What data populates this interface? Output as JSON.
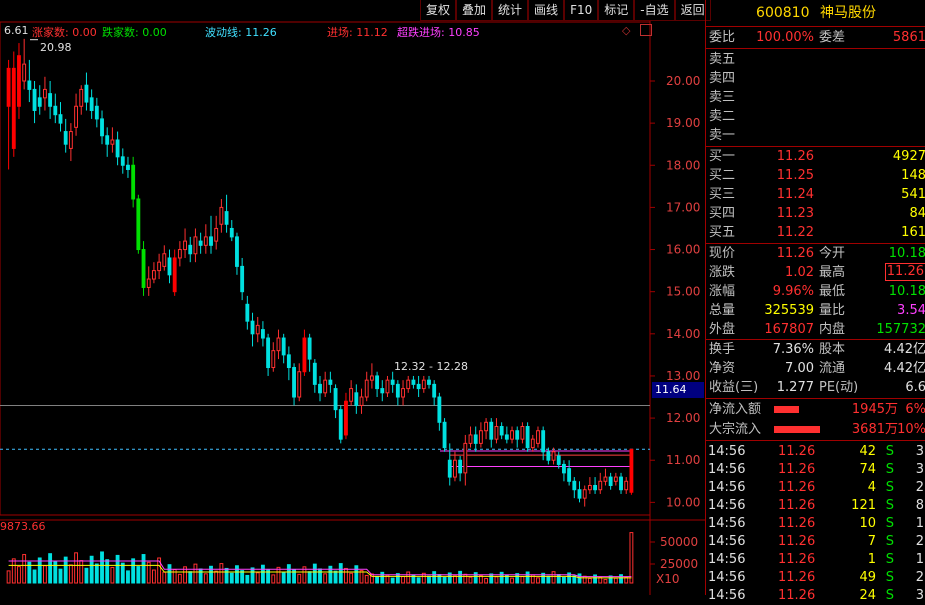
{
  "toolbar": [
    "复权",
    "叠加",
    "统计",
    "画线",
    "F10",
    "标记",
    "-自选",
    "返回"
  ],
  "legend": {
    "price_top": "6.61",
    "up_count": "涨家数: 0.00",
    "down_count": "跌家数: 0.00",
    "wave_line": "波动线: 11.26",
    "entry": "进场: 11.12",
    "super_entry": "超跌进场: 10.85"
  },
  "chart_labels": {
    "high_marker": "20.98",
    "range_label": "12.32 - 12.28",
    "current_price_tag": "11.64",
    "volume_value": "9873.66",
    "volume_ticks": [
      "50000",
      "25000",
      "X10"
    ]
  },
  "chart_data": {
    "type": "candlestick",
    "ylim": [
      9.7,
      21.4
    ],
    "y_ticks": [
      "20.00",
      "19.00",
      "18.00",
      "17.00",
      "16.00",
      "15.00",
      "14.00",
      "13.00",
      "12.00",
      "11.00",
      "10.00"
    ],
    "candles": [
      [
        19.4,
        20.3,
        20.5,
        17.9
      ],
      [
        18.4,
        20.3,
        20.7,
        18.2
      ],
      [
        19.4,
        20.6,
        20.9,
        19.1
      ],
      [
        20.0,
        20.4,
        21.0,
        19.8
      ],
      [
        20.0,
        19.8,
        20.5,
        19.5
      ],
      [
        19.8,
        19.3,
        20.0,
        19.0
      ],
      [
        19.6,
        19.4,
        19.9,
        19.2
      ],
      [
        19.6,
        19.8,
        20.1,
        19.3
      ],
      [
        19.7,
        19.4,
        20.0,
        19.1
      ],
      [
        19.4,
        19.2,
        19.7,
        19.0
      ],
      [
        19.2,
        19.0,
        19.5,
        18.8
      ],
      [
        18.8,
        18.5,
        19.1,
        18.3
      ],
      [
        18.4,
        18.8,
        19.0,
        18.1
      ],
      [
        18.9,
        19.4,
        19.7,
        18.7
      ],
      [
        19.4,
        19.8,
        19.9,
        19.2
      ],
      [
        19.9,
        19.5,
        20.2,
        19.3
      ],
      [
        19.6,
        19.3,
        19.8,
        19.1
      ],
      [
        19.4,
        19.1,
        19.6,
        18.9
      ],
      [
        19.1,
        18.7,
        19.3,
        18.5
      ],
      [
        18.7,
        18.5,
        18.9,
        18.2
      ],
      [
        18.5,
        18.6,
        18.9,
        18.3
      ],
      [
        18.6,
        18.2,
        18.8,
        18.0
      ],
      [
        18.2,
        18.0,
        18.4,
        17.8
      ],
      [
        18.0,
        17.9,
        18.2,
        17.7
      ],
      [
        18.0,
        17.2,
        18.2,
        17.0
      ],
      [
        17.2,
        16.0,
        17.3,
        15.9
      ],
      [
        16.0,
        15.1,
        16.2,
        14.9
      ],
      [
        15.1,
        15.3,
        15.6,
        14.9
      ],
      [
        15.3,
        15.5,
        15.7,
        15.2
      ],
      [
        15.5,
        15.7,
        15.9,
        15.3
      ],
      [
        15.6,
        15.9,
        16.1,
        15.5
      ],
      [
        15.8,
        15.4,
        16.0,
        15.2
      ],
      [
        15.0,
        15.8,
        16.0,
        14.9
      ],
      [
        15.8,
        16.0,
        16.2,
        15.6
      ],
      [
        16.0,
        16.2,
        16.5,
        15.8
      ],
      [
        16.1,
        15.9,
        16.3,
        15.7
      ],
      [
        15.9,
        16.3,
        16.5,
        15.7
      ],
      [
        16.2,
        16.1,
        16.4,
        15.9
      ],
      [
        16.1,
        16.3,
        16.6,
        15.9
      ],
      [
        16.3,
        16.1,
        16.8,
        15.9
      ],
      [
        16.2,
        16.5,
        16.8,
        16.0
      ],
      [
        16.6,
        17.0,
        17.2,
        16.4
      ],
      [
        16.9,
        16.6,
        17.3,
        16.4
      ],
      [
        16.5,
        16.3,
        16.7,
        16.2
      ],
      [
        16.3,
        15.6,
        16.4,
        15.4
      ],
      [
        15.6,
        15.0,
        15.8,
        14.8
      ],
      [
        14.7,
        14.3,
        14.9,
        14.1
      ],
      [
        14.3,
        14.0,
        14.5,
        13.7
      ],
      [
        14.0,
        14.2,
        14.4,
        13.8
      ],
      [
        14.1,
        13.9,
        14.3,
        13.7
      ],
      [
        13.9,
        13.2,
        14.0,
        13.0
      ],
      [
        13.2,
        13.6,
        13.8,
        13.1
      ],
      [
        13.6,
        13.9,
        14.1,
        13.4
      ],
      [
        13.9,
        13.5,
        14.0,
        13.3
      ],
      [
        13.5,
        13.2,
        13.7,
        12.9
      ],
      [
        13.2,
        12.5,
        13.3,
        12.3
      ],
      [
        12.5,
        13.1,
        13.3,
        12.4
      ],
      [
        13.1,
        13.9,
        14.1,
        13.0
      ],
      [
        13.9,
        13.4,
        14.0,
        13.1
      ],
      [
        13.3,
        12.8,
        13.4,
        12.6
      ],
      [
        12.8,
        12.6,
        13.0,
        12.4
      ],
      [
        12.6,
        12.9,
        13.1,
        12.5
      ],
      [
        12.9,
        12.8,
        13.1,
        12.6
      ],
      [
        12.7,
        12.2,
        12.8,
        12.0
      ],
      [
        12.2,
        11.5,
        12.3,
        11.4
      ],
      [
        11.6,
        12.4,
        12.6,
        11.5
      ],
      [
        12.4,
        12.7,
        12.9,
        12.3
      ],
      [
        12.6,
        12.3,
        12.8,
        12.1
      ],
      [
        12.3,
        12.5,
        12.7,
        12.1
      ],
      [
        12.5,
        12.9,
        13.1,
        12.4
      ],
      [
        12.9,
        13.0,
        13.3,
        12.7
      ],
      [
        13.0,
        12.7,
        13.1,
        12.5
      ],
      [
        12.7,
        12.6,
        12.9,
        12.4
      ],
      [
        12.6,
        12.9,
        13.0,
        12.5
      ],
      [
        12.9,
        12.8,
        13.1,
        12.6
      ],
      [
        12.8,
        12.5,
        12.9,
        12.3
      ],
      [
        12.5,
        12.7,
        12.9,
        12.3
      ],
      [
        12.7,
        12.9,
        13.0,
        12.6
      ],
      [
        12.9,
        12.8,
        13.0,
        12.7
      ],
      [
        12.8,
        12.7,
        13.0,
        12.5
      ],
      [
        12.7,
        12.9,
        13.0,
        12.6
      ],
      [
        12.9,
        12.8,
        13.0,
        12.7
      ],
      [
        12.8,
        12.5,
        12.9,
        12.3
      ],
      [
        12.5,
        11.9,
        12.6,
        11.7
      ],
      [
        11.9,
        11.3,
        12.0,
        11.2
      ],
      [
        11.0,
        10.6,
        11.4,
        10.4
      ],
      [
        10.6,
        11.0,
        11.2,
        10.5
      ],
      [
        11.0,
        10.7,
        11.1,
        10.5
      ],
      [
        10.7,
        11.4,
        11.6,
        10.4
      ],
      [
        11.4,
        11.6,
        11.8,
        11.3
      ],
      [
        11.6,
        11.4,
        11.8,
        11.2
      ],
      [
        11.4,
        11.7,
        11.9,
        11.3
      ],
      [
        11.7,
        11.9,
        12.0,
        11.5
      ],
      [
        11.9,
        11.5,
        12.0,
        11.3
      ],
      [
        11.5,
        11.8,
        12.0,
        11.4
      ],
      [
        11.8,
        11.6,
        11.9,
        11.5
      ],
      [
        11.6,
        11.5,
        11.8,
        11.4
      ],
      [
        11.5,
        11.7,
        11.8,
        11.4
      ],
      [
        11.7,
        11.5,
        11.8,
        11.3
      ],
      [
        11.5,
        11.8,
        11.9,
        11.4
      ],
      [
        11.8,
        11.3,
        11.9,
        11.2
      ],
      [
        11.3,
        11.5,
        11.6,
        11.2
      ],
      [
        11.4,
        11.7,
        11.8,
        11.3
      ],
      [
        11.7,
        11.2,
        11.8,
        11.0
      ],
      [
        11.2,
        11.0,
        11.3,
        10.9
      ],
      [
        11.0,
        11.2,
        11.3,
        10.9
      ],
      [
        11.1,
        10.9,
        11.2,
        10.8
      ],
      [
        10.9,
        10.7,
        11.0,
        10.5
      ],
      [
        10.8,
        10.5,
        11.0,
        10.4
      ],
      [
        10.5,
        10.3,
        10.6,
        10.1
      ],
      [
        10.3,
        10.1,
        10.5,
        10.0
      ],
      [
        10.1,
        10.3,
        10.4,
        9.9
      ],
      [
        10.3,
        10.4,
        10.6,
        10.2
      ],
      [
        10.4,
        10.3,
        10.6,
        10.2
      ],
      [
        10.3,
        10.5,
        10.7,
        10.2
      ],
      [
        10.5,
        10.6,
        10.8,
        10.4
      ],
      [
        10.6,
        10.4,
        10.7,
        10.3
      ],
      [
        10.5,
        10.6,
        10.7,
        10.4
      ],
      [
        10.6,
        10.3,
        10.7,
        10.2
      ],
      [
        10.3,
        10.5,
        10.6,
        10.2
      ],
      [
        10.24,
        11.26,
        11.26,
        10.18
      ]
    ],
    "volume_max": 60000
  },
  "panel": {
    "code": "600810",
    "name": "神马股份",
    "weibi_label": "委比",
    "weibi": "100.00%",
    "weicha_label": "委差",
    "weicha": "5861",
    "asks": [
      {
        "label": "卖五",
        "price": "",
        "vol": ""
      },
      {
        "label": "卖四",
        "price": "",
        "vol": ""
      },
      {
        "label": "卖三",
        "price": "",
        "vol": ""
      },
      {
        "label": "卖二",
        "price": "",
        "vol": ""
      },
      {
        "label": "卖一",
        "price": "",
        "vol": ""
      }
    ],
    "bids": [
      {
        "label": "买一",
        "price": "11.26",
        "vol": "4927"
      },
      {
        "label": "买二",
        "price": "11.25",
        "vol": "148"
      },
      {
        "label": "买三",
        "price": "11.24",
        "vol": "541"
      },
      {
        "label": "买四",
        "price": "11.23",
        "vol": "84"
      },
      {
        "label": "买五",
        "price": "11.22",
        "vol": "161"
      }
    ],
    "quote": [
      {
        "l1": "现价",
        "v1": "11.26",
        "c1": "red",
        "l2": "今开",
        "v2": "10.18",
        "c2": "green"
      },
      {
        "l1": "涨跌",
        "v1": "1.02",
        "c1": "red",
        "l2": "最高",
        "v2": "11.26",
        "c2": "red"
      },
      {
        "l1": "涨幅",
        "v1": "9.96%",
        "c1": "red",
        "l2": "最低",
        "v2": "10.18",
        "c2": "green"
      },
      {
        "l1": "总量",
        "v1": "325539",
        "c1": "yellow",
        "l2": "量比",
        "v2": "3.54",
        "c2": "magenta"
      },
      {
        "l1": "外盘",
        "v1": "167807",
        "c1": "red",
        "l2": "内盘",
        "v2": "157732",
        "c2": "green"
      }
    ],
    "fundamentals": [
      {
        "l1": "换手",
        "v1": "7.36%",
        "l2": "股本",
        "v2": "4.42亿"
      },
      {
        "l1": "净资",
        "v1": "7.00",
        "l2": "流通",
        "v2": "4.42亿"
      },
      {
        "l1": "收益(三)",
        "v1": "1.277",
        "l2": "PE(动)",
        "v2": "6.6"
      }
    ],
    "flows": [
      {
        "label": "净流入额",
        "amount": "1945万",
        "pct": "6%",
        "bar": 0.35
      },
      {
        "label": "大宗流入",
        "amount": "3681万",
        "pct": "10%",
        "bar": 0.65
      }
    ],
    "ticks": [
      {
        "time": "14:56",
        "price": "11.26",
        "vol": "42",
        "side": "S",
        "n": "3"
      },
      {
        "time": "14:56",
        "price": "11.26",
        "vol": "74",
        "side": "S",
        "n": "3"
      },
      {
        "time": "14:56",
        "price": "11.26",
        "vol": "4",
        "side": "S",
        "n": "2"
      },
      {
        "time": "14:56",
        "price": "11.26",
        "vol": "121",
        "side": "S",
        "n": "8"
      },
      {
        "time": "14:56",
        "price": "11.26",
        "vol": "10",
        "side": "S",
        "n": "1"
      },
      {
        "time": "14:56",
        "price": "11.26",
        "vol": "7",
        "side": "S",
        "n": "2"
      },
      {
        "time": "14:56",
        "price": "11.26",
        "vol": "1",
        "side": "S",
        "n": "1"
      },
      {
        "time": "14:56",
        "price": "11.26",
        "vol": "49",
        "side": "S",
        "n": "2"
      },
      {
        "time": "14:56",
        "price": "11.26",
        "vol": "24",
        "side": "S",
        "n": "3"
      }
    ]
  },
  "colors": {
    "up": "#ff3030",
    "down": "#00e0e0",
    "border": "#a00000",
    "ma": "#ff40ff",
    "ma2": "#ffff00"
  }
}
